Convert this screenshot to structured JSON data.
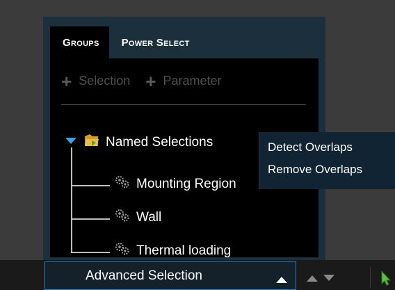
{
  "tabs": [
    {
      "label": "Groups",
      "active": true
    },
    {
      "label": "Power Select",
      "active": false
    }
  ],
  "toolbar": {
    "add_selection_label": "Selection",
    "add_parameter_label": "Parameter"
  },
  "tree": {
    "root_label": "Named Selections",
    "children": [
      {
        "label": "Mounting Region"
      },
      {
        "label": "Wall"
      },
      {
        "label": "Thermal loading"
      }
    ]
  },
  "context_menu": {
    "items": [
      {
        "label": "Detect Overlaps"
      },
      {
        "label": "Remove Overlaps"
      }
    ]
  },
  "bottom": {
    "advanced_selection_label": "Advanced Selection"
  },
  "colors": {
    "panel_bg": "#1b2f3d",
    "content_bg": "#000000",
    "accent_border": "#2a7fc0",
    "caret": "#3aa3e3",
    "cursor": "#5fbf3f"
  }
}
